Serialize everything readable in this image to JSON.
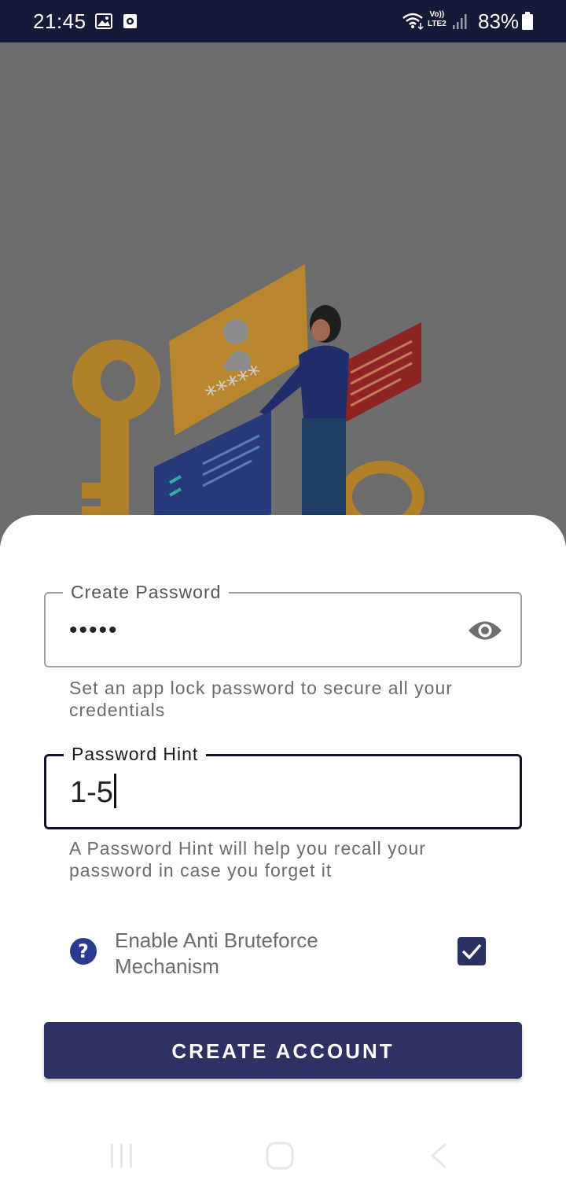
{
  "status_bar": {
    "time": "21:45",
    "volte_top": "Vo))",
    "volte_bottom": "LTE2",
    "battery": "83%"
  },
  "form": {
    "password": {
      "label": "Create Password",
      "value": "•••••",
      "helper": "Set an app lock password to secure all your credentials"
    },
    "hint": {
      "label": "Password Hint",
      "value": "1-5",
      "helper": "A Password Hint will help you recall your password in case you forget it"
    },
    "anti_bruteforce": {
      "label": "Enable Anti Bruteforce Mechanism",
      "checked": true
    },
    "submit_label": "CREATE ACCOUNT"
  },
  "colors": {
    "status_bar": "#151a38",
    "accent": "#2e3162",
    "help_icon": "#2b3a91"
  }
}
